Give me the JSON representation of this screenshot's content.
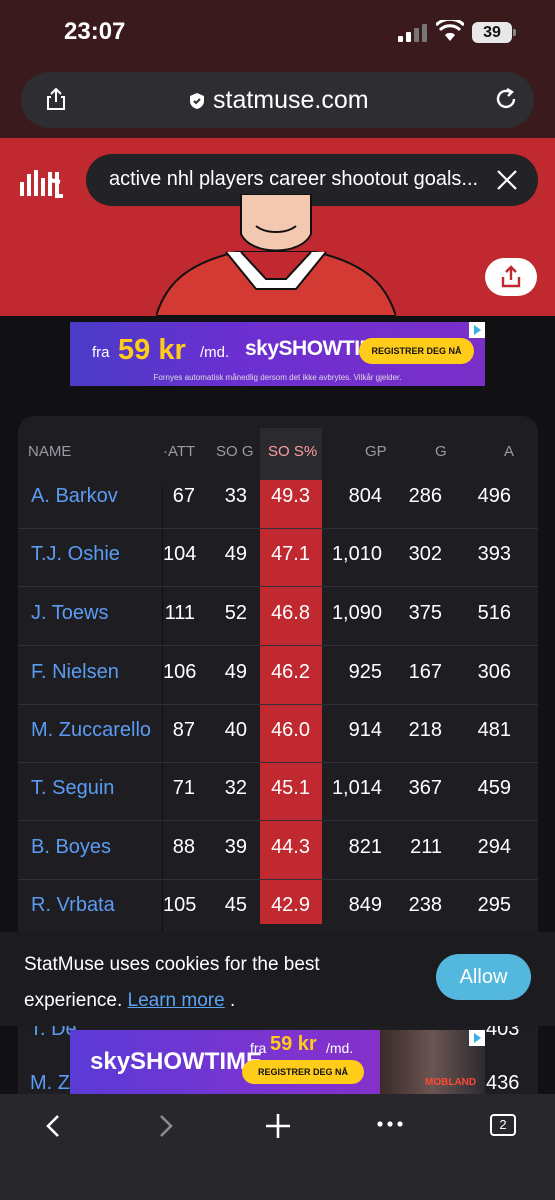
{
  "status": {
    "time": "23:07",
    "battery": "39"
  },
  "browser": {
    "url": "statmuse.com",
    "tab_count": "2"
  },
  "search": {
    "query": "active nhl players career shootout goals..."
  },
  "ad_top": {
    "prefix": "fra",
    "price": "59 kr",
    "suffix": "/md.",
    "brand": "skySHOWTIME",
    "cta": "REGISTRER DEG NÅ",
    "fine_print": "Fornyes automatisk månedlig dersom det ikke avbrytes. Vilkår gjelder."
  },
  "table": {
    "headers": [
      "NAME",
      "ATT",
      "SO G",
      "SO S%",
      "GP",
      "G",
      "A"
    ],
    "rows": [
      {
        "name": "A. Barkov",
        "att": "67",
        "sog": "33",
        "sos": "49.3",
        "gp": "804",
        "g": "286",
        "a": "496"
      },
      {
        "name": "T.J. Oshie",
        "att": "104",
        "sog": "49",
        "sos": "47.1",
        "gp": "1,010",
        "g": "302",
        "a": "393"
      },
      {
        "name": "J. Toews",
        "att": "111",
        "sog": "52",
        "sos": "46.8",
        "gp": "1,090",
        "g": "375",
        "a": "516"
      },
      {
        "name": "F. Nielsen",
        "att": "106",
        "sog": "49",
        "sos": "46.2",
        "gp": "925",
        "g": "167",
        "a": "306"
      },
      {
        "name": "M. Zuccarello",
        "att": "87",
        "sog": "40",
        "sos": "46.0",
        "gp": "914",
        "g": "218",
        "a": "481"
      },
      {
        "name": "T. Seguin",
        "att": "71",
        "sog": "32",
        "sos": "45.1",
        "gp": "1,014",
        "g": "367",
        "a": "459"
      },
      {
        "name": "B. Boyes",
        "att": "88",
        "sog": "39",
        "sos": "44.3",
        "gp": "821",
        "g": "211",
        "a": "294"
      },
      {
        "name": "R. Vrbata",
        "att": "105",
        "sog": "45",
        "sos": "42.9",
        "gp": "849",
        "g": "238",
        "a": "295"
      }
    ],
    "partial_rows": [
      {
        "name": "T. De",
        "a": "403"
      },
      {
        "name": "M. Z",
        "a": "436"
      }
    ]
  },
  "cookie": {
    "text": "StatMuse uses cookies for the best experience.",
    "link": "Learn more",
    "period": ".",
    "allow": "Allow"
  },
  "ad_bottom": {
    "brand": "skySHOWTIME",
    "prefix": "fra",
    "price": "59 kr",
    "suffix": "/md.",
    "cta": "REGISTRER DEG NÅ",
    "show": "MOBLAND"
  }
}
